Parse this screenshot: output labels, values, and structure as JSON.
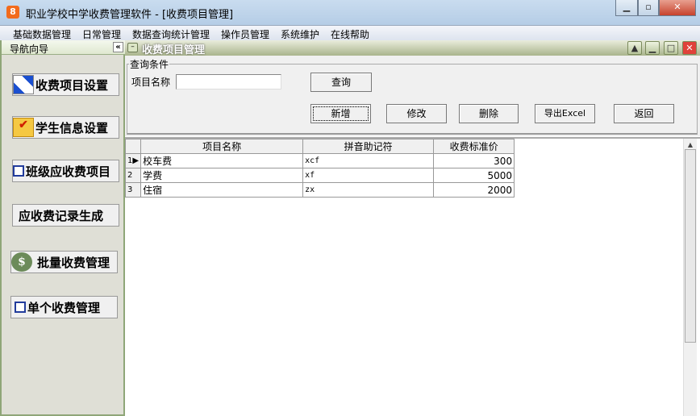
{
  "window": {
    "title": "职业学校中学收费管理软件  - [收费项目管理]",
    "icon_text": "8"
  },
  "menu": [
    "基础数据管理",
    "日常管理",
    "数据查询统计管理",
    "操作员管理",
    "系统维护",
    "在线帮助"
  ],
  "nav": {
    "title": "导航向导",
    "collapse": "«",
    "items": [
      {
        "label": "收费项目设置",
        "icon": "table-edit-icon"
      },
      {
        "label": "学生信息设置",
        "icon": "folder-checklist-icon"
      },
      {
        "label": "班级应收费项目",
        "icon": "card-hand-icon"
      },
      {
        "label": "应收费记录生成",
        "icon": ""
      },
      {
        "label": "批量收费管理",
        "icon": "money-bag-icon"
      },
      {
        "label": "单个收费管理",
        "icon": "card-hand-icon"
      }
    ]
  },
  "child": {
    "title": "收费项目管理",
    "query": {
      "legend": "查询条件",
      "field_label": "项目名称",
      "field_value": "",
      "search": "查询"
    },
    "actions": {
      "add": "新增",
      "edit": "修改",
      "delete": "删除",
      "export": "导出Excel",
      "back": "返回"
    },
    "table": {
      "headers": [
        "项目名称",
        "拼音助记符",
        "收费标准价"
      ],
      "rows": [
        {
          "n": "1",
          "name": "校车费",
          "py": "xcf",
          "price": "300"
        },
        {
          "n": "2",
          "name": "学费",
          "py": "xf",
          "price": "5000"
        },
        {
          "n": "3",
          "name": "住宿",
          "py": "zx",
          "price": "2000"
        }
      ]
    }
  }
}
